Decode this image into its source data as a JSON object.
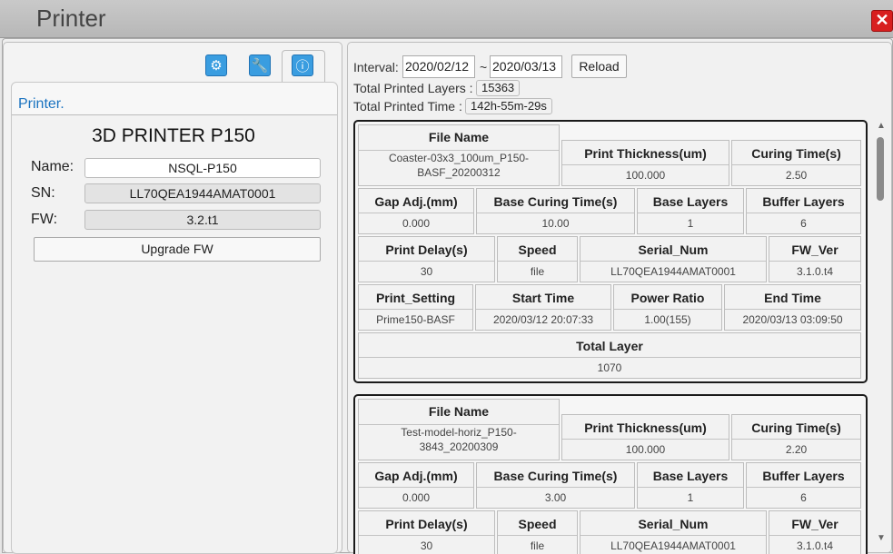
{
  "window": {
    "title": "Printer",
    "close_label": "✕"
  },
  "left_panel": {
    "tabs": [
      {
        "icon": "settings-icon",
        "label": "⚙"
      },
      {
        "icon": "wrench-icon",
        "label": "🔧"
      },
      {
        "icon": "info-icon",
        "label": "ⓘ"
      }
    ],
    "section_title": "Printer.",
    "model": "3D PRINTER P150",
    "name_label": "Name:",
    "name_value": "NSQL-P150",
    "sn_label": "SN:",
    "sn_value": "LL70QEA1944AMAT0001",
    "fw_label": "FW:",
    "fw_value": "3.2.t1",
    "upgrade_label": "Upgrade FW"
  },
  "right_panel": {
    "interval_label": "Interval:",
    "date_from": "2020/02/12",
    "range_sep": "~",
    "date_to": "2020/03/13",
    "reload_label": "Reload",
    "total_layers_label": "Total Printed Layers :",
    "total_layers_value": "15363",
    "total_time_label": "Total Printed Time :",
    "total_time_value": "142h-55m-29s",
    "headers": {
      "file_name": "File Name",
      "print_thickness": "Print Thickness(um)",
      "curing_time": "Curing Time(s)",
      "gap_adj": "Gap Adj.(mm)",
      "base_curing": "Base Curing Time(s)",
      "base_layers": "Base Layers",
      "buffer_layers": "Buffer Layers",
      "print_delay": "Print Delay(s)",
      "speed": "Speed",
      "serial_num": "Serial_Num",
      "fw_ver": "FW_Ver",
      "print_setting": "Print_Setting",
      "start_time": "Start Time",
      "power_ratio": "Power Ratio",
      "end_time": "End Time",
      "total_layer": "Total Layer"
    },
    "records": [
      {
        "file_name": "Coaster-03x3_100um_P150-BASF_20200312",
        "print_thickness": "100.000",
        "curing_time": "2.50",
        "gap_adj": "0.000",
        "base_curing": "10.00",
        "base_layers": "1",
        "buffer_layers": "6",
        "print_delay": "30",
        "speed": "file",
        "serial_num": "LL70QEA1944AMAT0001",
        "fw_ver": "3.1.0.t4",
        "print_setting": "Prime150-BASF",
        "start_time": "2020/03/12 20:07:33",
        "power_ratio": "1.00(155)",
        "end_time": "2020/03/13 03:09:50",
        "total_layer": "1070"
      },
      {
        "file_name": "Test-model-horiz_P150-3843_20200309",
        "print_thickness": "100.000",
        "curing_time": "2.20",
        "gap_adj": "0.000",
        "base_curing": "3.00",
        "base_layers": "1",
        "buffer_layers": "6",
        "print_delay": "30",
        "speed": "file",
        "serial_num": "LL70QEA1944AMAT0001",
        "fw_ver": "3.1.0.t4"
      }
    ]
  }
}
